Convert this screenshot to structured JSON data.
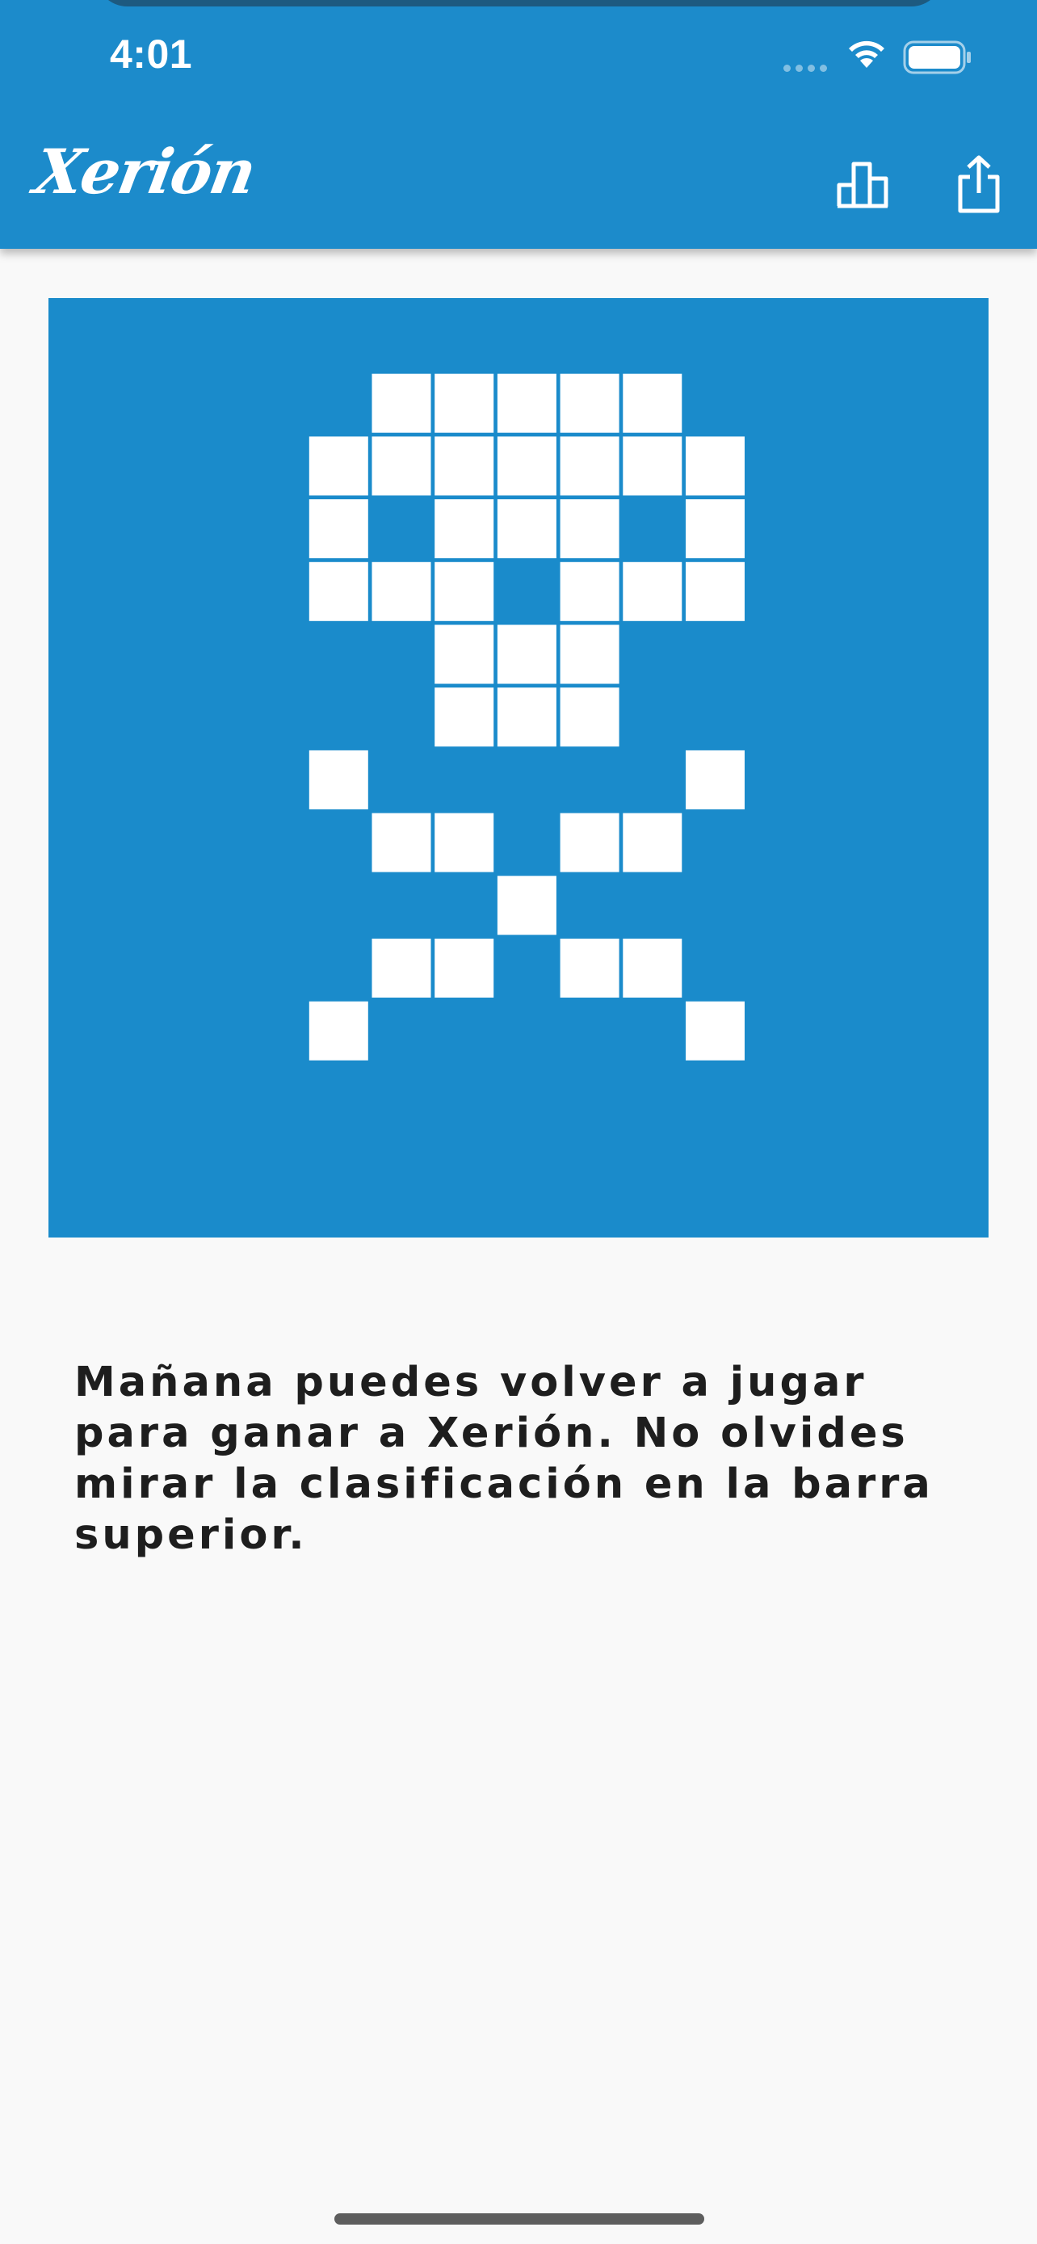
{
  "status_bar": {
    "time": "4:01"
  },
  "app_bar": {
    "logo_text": "Xerión",
    "icons": {
      "leaderboard": "leaderboard-icon",
      "share": "share-icon"
    }
  },
  "board": {
    "background_color": "#1a8bcb",
    "cell_color": "#ffffff",
    "columns": 15,
    "rows": 15,
    "filled_cells": [
      [
        1,
        5
      ],
      [
        1,
        6
      ],
      [
        1,
        7
      ],
      [
        1,
        8
      ],
      [
        1,
        9
      ],
      [
        2,
        4
      ],
      [
        2,
        5
      ],
      [
        2,
        6
      ],
      [
        2,
        7
      ],
      [
        2,
        8
      ],
      [
        2,
        9
      ],
      [
        2,
        10
      ],
      [
        3,
        4
      ],
      [
        3,
        6
      ],
      [
        3,
        7
      ],
      [
        3,
        8
      ],
      [
        3,
        10
      ],
      [
        4,
        4
      ],
      [
        4,
        5
      ],
      [
        4,
        6
      ],
      [
        4,
        8
      ],
      [
        4,
        9
      ],
      [
        4,
        10
      ],
      [
        5,
        6
      ],
      [
        5,
        7
      ],
      [
        5,
        8
      ],
      [
        6,
        6
      ],
      [
        6,
        7
      ],
      [
        6,
        8
      ],
      [
        7,
        4
      ],
      [
        7,
        10
      ],
      [
        8,
        5
      ],
      [
        8,
        6
      ],
      [
        8,
        8
      ],
      [
        8,
        9
      ],
      [
        9,
        7
      ],
      [
        10,
        5
      ],
      [
        10,
        6
      ],
      [
        10,
        8
      ],
      [
        10,
        9
      ],
      [
        11,
        4
      ],
      [
        11,
        10
      ]
    ]
  },
  "message": "Mañana puedes volver a jugar para ganar a Xerión. No olvides mirar la clasificación en la barra superior.",
  "colors": {
    "primary": "#1c8bcb",
    "background": "#f9f9f9",
    "text": "#1e1e1e"
  }
}
